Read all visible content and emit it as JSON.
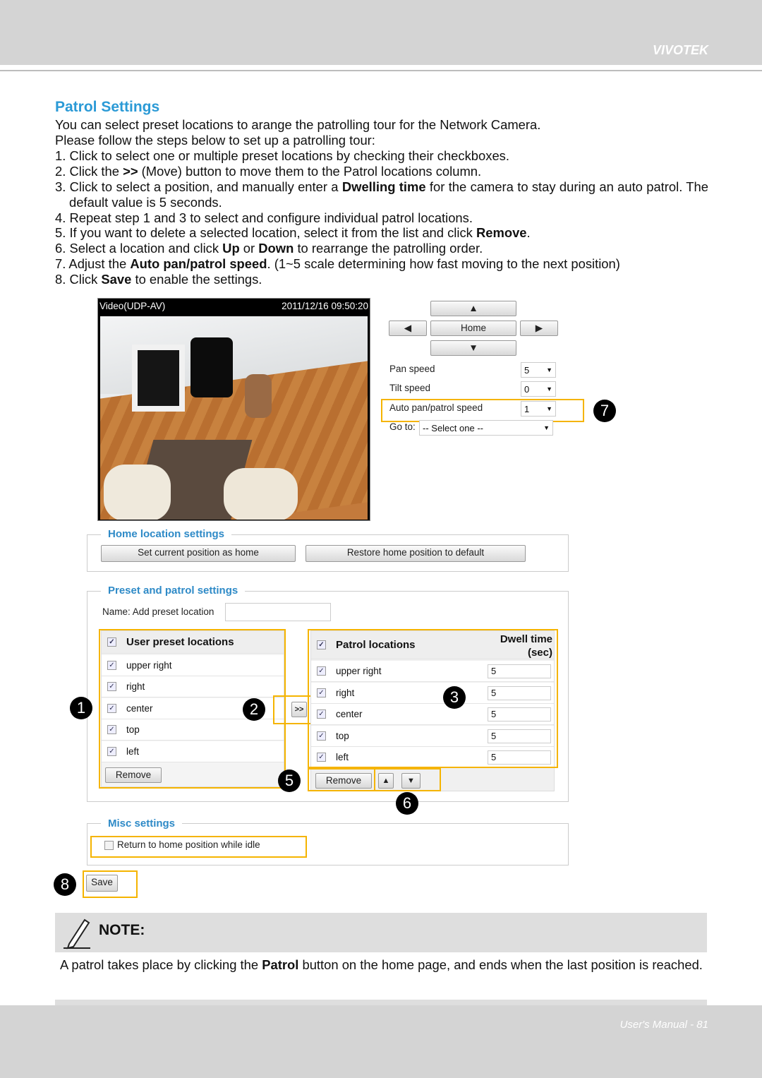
{
  "header": {
    "brand": "VIVOTEK"
  },
  "title": "Patrol Settings",
  "intro": [
    "You can select preset locations to arange the patrolling tour for the Network Camera.",
    "Please follow the steps below to set up a patrolling tour:"
  ],
  "steps": [
    {
      "a": "1. Click to select one or multiple preset locations by checking their checkboxes."
    },
    {
      "a": "2. Click the ",
      "b": ">>",
      "c": " (Move) button to move them to the Patrol locations column."
    },
    {
      "a": "3. Click to select a position, and manually enter a ",
      "b": "Dwelling time",
      "c": " for the camera to stay during an auto patrol. The default value is 5 seconds."
    },
    {
      "a": "4. Repeat step 1 and 3 to select and configure individual patrol locations."
    },
    {
      "a": "5. If you want to delete a selected location, select it from the list and click ",
      "b": "Remove",
      "c": "."
    },
    {
      "a": "6. Select a location and click ",
      "b": "Up",
      "c": " or ",
      "d": "Down",
      "e": " to rearrange the patrolling order."
    },
    {
      "a": "7. Adjust the ",
      "b": "Auto pan/patrol speed",
      "c": ". (1~5 scale determining how fast moving to the next position)"
    },
    {
      "a": "8. Click ",
      "b": "Save",
      "c": " to enable the settings."
    }
  ],
  "ui": {
    "video_label": "Video(UDP-AV)",
    "timestamp": "2011/12/16 09:50:20",
    "nav": {
      "up": "▲",
      "down": "▼",
      "left": "◀",
      "right": "▶",
      "home": "Home"
    },
    "pan_speed": {
      "label": "Pan speed",
      "value": "5"
    },
    "tilt_speed": {
      "label": "Tilt speed",
      "value": "0"
    },
    "patrol_speed": {
      "label": "Auto pan/patrol speed",
      "value": "1"
    },
    "goto": {
      "label": "Go to:",
      "value": "-- Select one --"
    },
    "home_section": {
      "legend": "Home location settings",
      "set_home": "Set current position as home",
      "restore_home": "Restore home position to default"
    },
    "preset_section": {
      "legend": "Preset and patrol settings",
      "name_label": "Name: Add preset location",
      "name_value": ""
    },
    "user_presets": {
      "header": "User preset locations",
      "items": [
        "upper right",
        "right",
        "center",
        "top",
        "left"
      ],
      "remove": "Remove"
    },
    "move_button": ">>",
    "patrol": {
      "header": "Patrol locations",
      "dwell_header": "Dwell time",
      "dwell_unit": "(sec)",
      "items": [
        {
          "name": "upper right",
          "dwell": "5"
        },
        {
          "name": "right",
          "dwell": "5"
        },
        {
          "name": "center",
          "dwell": "5"
        },
        {
          "name": "top",
          "dwell": "5"
        },
        {
          "name": "left",
          "dwell": "5"
        }
      ],
      "remove": "Remove",
      "up": "▲",
      "down": "▼"
    },
    "misc": {
      "legend": "Misc settings",
      "return_home": "Return to home position while idle",
      "return_home_checked": false
    },
    "save": "Save",
    "callouts": [
      "1",
      "2",
      "3",
      "5",
      "6",
      "7",
      "8"
    ],
    "highlight_color": "#f5b400"
  },
  "note": {
    "title": "NOTE:",
    "a": "A patrol takes place by clicking the ",
    "b": "Patrol",
    "c": " button on the home page, and ends when the last position is reached."
  },
  "footer": {
    "page": "User's Manual - 81"
  }
}
